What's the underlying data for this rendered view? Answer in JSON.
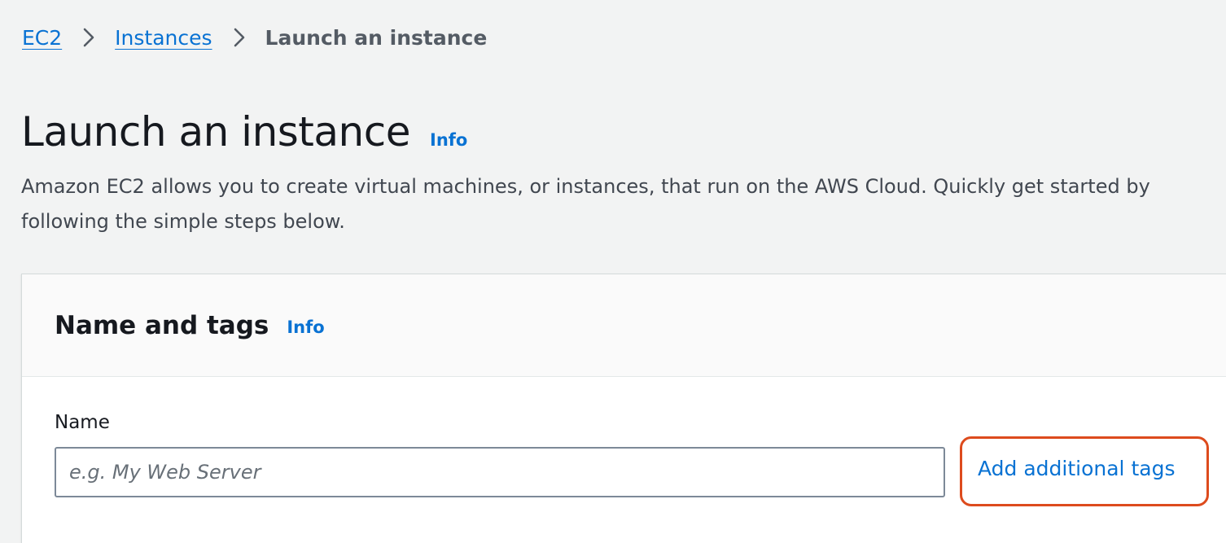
{
  "breadcrumb": {
    "items": [
      {
        "label": "EC2"
      },
      {
        "label": "Instances"
      },
      {
        "label": "Launch an instance"
      }
    ],
    "separator_icon": "chevron-right-icon"
  },
  "header": {
    "title": "Launch an instance",
    "info_label": "Info",
    "description": "Amazon EC2 allows you to create virtual machines, or instances, that run on the AWS Cloud. Quickly get started by following the simple steps below."
  },
  "name_and_tags": {
    "title": "Name and tags",
    "info_label": "Info",
    "name_label": "Name",
    "name_value": "",
    "name_placeholder": "e.g. My Web Server",
    "add_tags_label": "Add additional tags"
  },
  "colors": {
    "link": "#0972d3",
    "highlight": "#dd4b1d",
    "page_bg": "#f2f3f3"
  }
}
